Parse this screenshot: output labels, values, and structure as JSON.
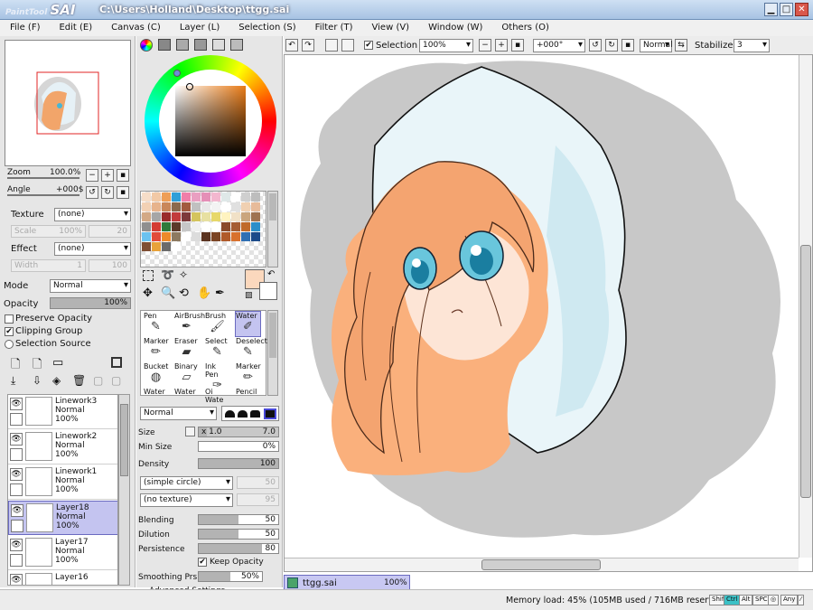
{
  "window": {
    "logo_small": "PaintTool",
    "logo_big": "SAI",
    "title": "C:\\Users\\Holland\\Desktop\\ttgg.sai"
  },
  "menu": [
    "File (F)",
    "Edit (E)",
    "Canvas (C)",
    "Layer (L)",
    "Selection (S)",
    "Filter (T)",
    "View (V)",
    "Window (W)",
    "Others (O)"
  ],
  "navigator": {
    "zoom_label": "Zoom",
    "zoom_value": "100.0%",
    "angle_label": "Angle",
    "angle_value": "+000$"
  },
  "texture": {
    "label": "Texture",
    "value": "(none)",
    "scale_label": "Scale",
    "scale_value": "100%",
    "scale_num": "20"
  },
  "effect": {
    "label": "Effect",
    "value": "(none)",
    "width_label": "Width",
    "width_value": "1",
    "width_num": "100"
  },
  "blend": {
    "mode_label": "Mode",
    "mode_value": "Normal",
    "opacity_label": "Opacity",
    "opacity_value": "100%"
  },
  "options": {
    "preserve": "Preserve Opacity",
    "clipping": "Clipping Group",
    "source": "Selection Source"
  },
  "layers": [
    {
      "name": "Linework3",
      "mode": "Normal",
      "opacity": "100%",
      "active": false
    },
    {
      "name": "Linework2",
      "mode": "Normal",
      "opacity": "100%",
      "active": false
    },
    {
      "name": "Linework1",
      "mode": "Normal",
      "opacity": "100%",
      "active": false
    },
    {
      "name": "Layer18",
      "mode": "Normal",
      "opacity": "100%",
      "active": true
    },
    {
      "name": "Layer17",
      "mode": "Normal",
      "opacity": "100%",
      "active": false
    },
    {
      "name": "Layer16",
      "mode": "",
      "opacity": "",
      "active": false
    }
  ],
  "swatch_colors": [
    "#f6ddc8",
    "#f2c9a6",
    "#ee9e57",
    "#2f9fd8",
    "#f07ea9",
    "#e99fc1",
    "#e58fb7",
    "#f3b7cf",
    "#dfe8e8",
    "#ffffff",
    "#cfcfcf",
    "#bdbdbd",
    "#f3d1b4",
    "#e7b38c",
    "#c9875a",
    "#8b6a4d",
    "#a25a3f",
    "#c0c0c0",
    "#e8e8e8",
    "#f3f3f3",
    "#ffffff",
    "#e0e0e0",
    "#f0d0b2",
    "#e7bb9a",
    "#d3a985",
    "#a6a6a6",
    "#9a2b2b",
    "#c23b3b",
    "#7d3a3a",
    "#d4c45d",
    "#e7e0a1",
    "#e7d86a",
    "#fff3c0",
    "#f1e1c7",
    "#caa57e",
    "#9f7351",
    "#8f8f8f",
    "#d43c34",
    "#2f7a3b",
    "#5c3a2a",
    "#c7c7c7",
    "#f0f0f0",
    "#ffffff",
    "#ffffff",
    "#8a4a2a",
    "#a55d33",
    "#c06a2a",
    "#2b8ec9",
    "#6ac2f0",
    "#e24b3a",
    "#ee8a2a",
    "#8d7a61",
    "#ffffff",
    "#dcdcdc",
    "#5b3421",
    "#7b4424",
    "#b05a2a",
    "#d8712e",
    "#2f6fb3",
    "#1c4b8a",
    "#7f4f34",
    "#e8a23a",
    "#6b6b6b",
    "#ffffff"
  ],
  "tools": [
    {
      "name": "Pen",
      "icon": "pen-icon",
      "glyph": "✎"
    },
    {
      "name": "AirBrush",
      "icon": "airbrush-icon",
      "glyph": "✒"
    },
    {
      "name": "Brush",
      "icon": "brush-icon",
      "glyph": "🖌"
    },
    {
      "name": "Water",
      "icon": "water-brush-icon",
      "glyph": "✐"
    },
    {
      "name": "Marker",
      "icon": "marker-icon",
      "glyph": "✏"
    },
    {
      "name": "Eraser",
      "icon": "eraser-icon",
      "glyph": "▰"
    },
    {
      "name": "Select",
      "icon": "select-brush-icon",
      "glyph": "✎"
    },
    {
      "name": "Deselect",
      "icon": "deselect-brush-icon",
      "glyph": "✎"
    },
    {
      "name": "Bucket",
      "icon": "bucket-icon",
      "glyph": "◍"
    },
    {
      "name": "Binary",
      "icon": "binary-pen-icon",
      "glyph": "▱"
    },
    {
      "name": "Ink Pen",
      "icon": "ink-pen-icon",
      "glyph": "✑"
    },
    {
      "name": "Marker",
      "icon": "marker-icon",
      "glyph": "✏"
    },
    {
      "name": "Water",
      "icon": "water-icon",
      "glyph": ""
    },
    {
      "name": "Water",
      "icon": "water-icon",
      "glyph": ""
    },
    {
      "name": "Oi Wate",
      "icon": "oil-water-icon",
      "glyph": ""
    },
    {
      "name": "Pencil",
      "icon": "pencil-icon",
      "glyph": ""
    }
  ],
  "brush": {
    "mode": "Normal",
    "size_label": "Size",
    "size_mult": "x 1.0",
    "size_value": "7.0",
    "minsize_label": "Min Size",
    "minsize_value": "0%",
    "minsize_pct": 0,
    "density_label": "Density",
    "density_value": "100",
    "density_pct": 100,
    "shape": "(simple circle)",
    "shape_num": "50",
    "texture": "(no texture)",
    "texture_num": "95",
    "blending_label": "Blending",
    "blending_value": "50",
    "blending_pct": 50,
    "dilution_label": "Dilution",
    "dilution_value": "50",
    "dilution_pct": 50,
    "persistence_label": "Persistence",
    "persistence_value": "80",
    "persistence_pct": 80,
    "keep_opacity": "Keep Opacity",
    "smoothing_label": "Smoothing Prs",
    "smoothing_value": "50%",
    "smoothing_pct": 50,
    "advanced": "Advanced Settings"
  },
  "toolbar": {
    "selection": "Selection",
    "zoom": "100%",
    "angle": "+000°",
    "blend": "Normal",
    "stabilizer_label": "Stabilizer",
    "stabilizer_value": "3"
  },
  "doc_tab": {
    "name": "ttgg.sai",
    "zoom": "100%"
  },
  "status": {
    "memory": "Memory load: 45% (105MB used / 716MB reserved)",
    "keys": [
      "Shift",
      "Ctrl",
      "Alt",
      "SPC",
      "◎",
      "Any",
      "⁄"
    ]
  }
}
